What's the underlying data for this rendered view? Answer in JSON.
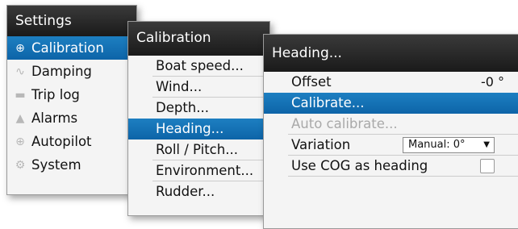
{
  "settings": {
    "title": "Settings",
    "items": [
      {
        "label": "Calibration",
        "icon": "compass-icon",
        "glyph": "⊕",
        "selected": true
      },
      {
        "label": "Damping",
        "icon": "waveform-icon",
        "glyph": "∿",
        "selected": false
      },
      {
        "label": "Trip log",
        "icon": "log-icon",
        "glyph": "▬",
        "selected": false
      },
      {
        "label": "Alarms",
        "icon": "bell-icon",
        "glyph": "▲",
        "selected": false
      },
      {
        "label": "Autopilot",
        "icon": "steering-wheel-icon",
        "glyph": "⊕",
        "selected": false
      },
      {
        "label": "System",
        "icon": "gear-icon",
        "glyph": "⚙",
        "selected": false
      }
    ]
  },
  "calibration": {
    "title": "Calibration",
    "items": [
      {
        "label": "Boat speed...",
        "selected": false
      },
      {
        "label": "Wind...",
        "selected": false
      },
      {
        "label": "Depth...",
        "selected": false
      },
      {
        "label": "Heading...",
        "selected": true
      },
      {
        "label": "Roll / Pitch...",
        "selected": false
      },
      {
        "label": "Environment...",
        "selected": false
      },
      {
        "label": "Rudder...",
        "selected": false
      }
    ]
  },
  "heading": {
    "title": "Heading...",
    "offset_label": "Offset",
    "offset_value": "-0 °",
    "calibrate_label": "Calibrate...",
    "auto_calibrate_label": "Auto calibrate...",
    "variation_label": "Variation",
    "variation_value": "Manual:  0°",
    "use_cog_label": "Use COG as heading",
    "use_cog_checked": false
  },
  "colors": {
    "selected": "#1272b6",
    "title_bar": "#262626"
  }
}
